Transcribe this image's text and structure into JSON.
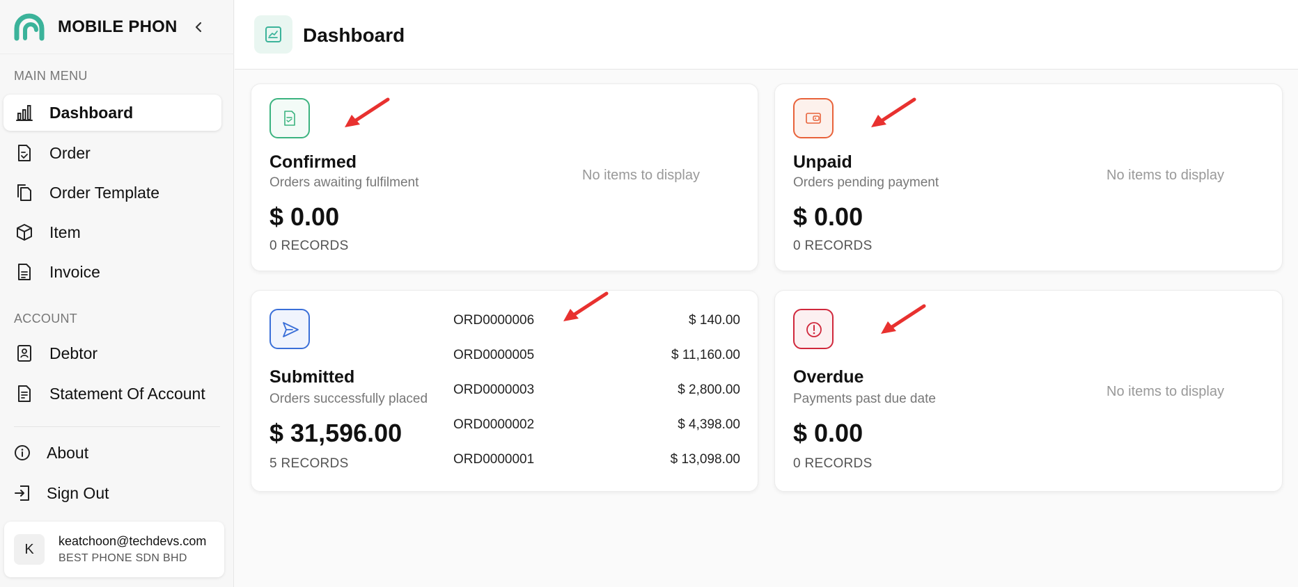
{
  "sidebar": {
    "brand": "MOBILE PHON",
    "main_menu_label": "MAIN MENU",
    "account_label": "ACCOUNT",
    "items": [
      {
        "label": "Dashboard",
        "icon": "bar-chart-icon",
        "active": true
      },
      {
        "label": "Order",
        "icon": "order-doc-icon"
      },
      {
        "label": "Order Template",
        "icon": "copy-icon"
      },
      {
        "label": "Item",
        "icon": "box-icon"
      },
      {
        "label": "Invoice",
        "icon": "invoice-icon"
      }
    ],
    "account_items": [
      {
        "label": "Debtor",
        "icon": "contact-book-icon"
      },
      {
        "label": "Statement Of Account",
        "icon": "statement-icon"
      }
    ],
    "footer_items": [
      {
        "label": "About",
        "icon": "info-icon"
      },
      {
        "label": "Sign Out",
        "icon": "sign-out-icon"
      }
    ],
    "user": {
      "initial": "K",
      "email": "keatchoon@techdevs.com",
      "company": "BEST PHONE SDN BHD"
    }
  },
  "header": {
    "title": "Dashboard"
  },
  "cards": {
    "confirmed": {
      "title": "Confirmed",
      "subtitle": "Orders awaiting fulfilment",
      "amount": "$ 0.00",
      "records": "0 RECORDS",
      "empty": "No items to display",
      "color": "#3bb37f"
    },
    "unpaid": {
      "title": "Unpaid",
      "subtitle": "Orders pending payment",
      "amount": "$ 0.00",
      "records": "0 RECORDS",
      "empty": "No items to display",
      "color": "#e8623a"
    },
    "submitted": {
      "title": "Submitted",
      "subtitle": "Orders successfully placed",
      "amount": "$ 31,596.00",
      "records": "5 RECORDS",
      "color": "#3a6fd8",
      "orders": [
        {
          "id": "ORD0000006",
          "amount": "$ 140.00"
        },
        {
          "id": "ORD0000005",
          "amount": "$ 11,160.00"
        },
        {
          "id": "ORD0000003",
          "amount": "$ 2,800.00"
        },
        {
          "id": "ORD0000002",
          "amount": "$ 4,398.00"
        },
        {
          "id": "ORD0000001",
          "amount": "$ 13,098.00"
        }
      ]
    },
    "overdue": {
      "title": "Overdue",
      "subtitle": "Payments past due date",
      "amount": "$ 0.00",
      "records": "0 RECORDS",
      "empty": "No items to display",
      "color": "#d0283c"
    }
  },
  "colors": {
    "brand": "#3bb39a",
    "annotation_arrow": "#e8312f"
  }
}
